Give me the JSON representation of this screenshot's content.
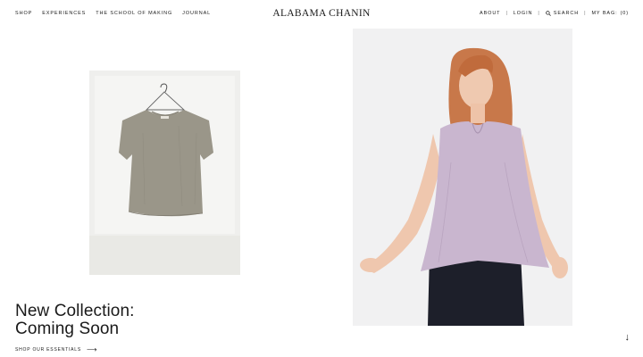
{
  "nav": {
    "left": [
      "SHOP",
      "EXPERIENCES",
      "THE SCHOOL OF MAKING",
      "JOURNAL"
    ],
    "logo": "ALABAMA CHANIN",
    "right": {
      "about": "ABOUT",
      "login": "LOGIN",
      "search": "SEARCH",
      "bag_label": "MY BAG:",
      "bag_count": "(0)",
      "separator": "|"
    }
  },
  "hero": {
    "line1": "New Collection:",
    "line2": "Coming Soon",
    "cta": "SHOP OUR ESSENTIALS",
    "cta_arrow": "⟶",
    "scroll_arrow": "↓"
  },
  "images": {
    "left": "product-tee-on-hanger",
    "right": "model-in-lavender-top"
  },
  "colors": {
    "background": "#ffffff",
    "text": "#1a1a1a",
    "tee": "#9a9689",
    "top": "#c9b6cf",
    "hair": "#c8784a",
    "skirt": "#1d1f2a"
  }
}
